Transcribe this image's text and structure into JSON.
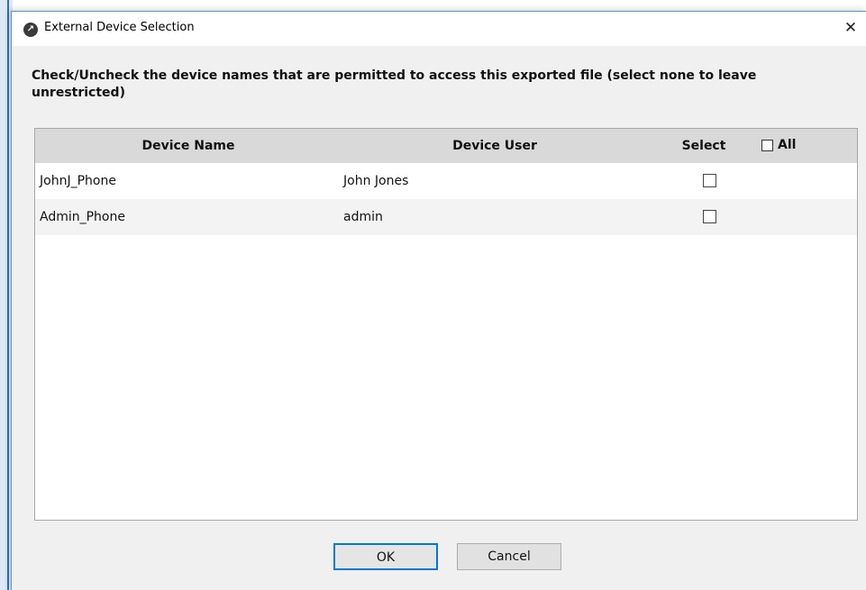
{
  "window": {
    "title": "External Device Selection",
    "close_glyph": "✕",
    "app_icon_glyph": "↗"
  },
  "instruction": "Check/Uncheck the device names that are permitted to access this exported file (select none to leave unrestricted)",
  "table": {
    "columns": {
      "device_name": "Device Name",
      "device_user": "Device User",
      "select": "Select",
      "all": "All"
    },
    "all_checked": false,
    "rows": [
      {
        "device_name": "JohnJ_Phone",
        "device_user": "John Jones",
        "selected": false
      },
      {
        "device_name": "Admin_Phone",
        "device_user": "admin",
        "selected": false
      }
    ]
  },
  "buttons": {
    "ok": "OK",
    "cancel": "Cancel"
  },
  "colors": {
    "accent": "#0078d7",
    "header_bg": "#d9d9d9",
    "dialog_bg": "#f0f0f0"
  },
  "icons": {
    "app": "app-logo-icon",
    "close": "close-icon",
    "checkbox": "checkbox-icon"
  }
}
